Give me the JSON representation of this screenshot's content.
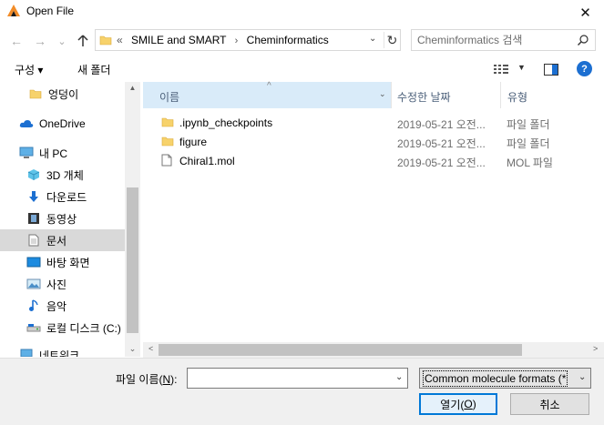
{
  "window": {
    "title": "Open File",
    "close_glyph": "✕",
    "app_icon": "app-logo-icon"
  },
  "nav": {
    "back_glyph": "←",
    "forward_glyph": "→",
    "recent_glyph": "⌄",
    "up_glyph": "🡡",
    "breadcrumb_prefix": "«",
    "breadcrumb": [
      "SMILE and SMART",
      "Cheminformatics"
    ],
    "breadcrumb_separator": "›",
    "search_placeholder": "Cheminformatics 검색"
  },
  "toolbar": {
    "organize_label": "구성 ▾",
    "new_folder_label": "새 폴더",
    "help_label": "?"
  },
  "sidebar": {
    "items": [
      {
        "label": "엉덩이",
        "icon": "folder-icon",
        "selected": false
      },
      {
        "label": "OneDrive",
        "icon": "cloud-icon",
        "selected": false
      },
      {
        "label": "내 PC",
        "icon": "computer-icon",
        "selected": false
      },
      {
        "label": "3D 개체",
        "icon": "cube-3d-icon",
        "selected": false
      },
      {
        "label": "다운로드",
        "icon": "download-arrow-icon",
        "selected": false
      },
      {
        "label": "동영상",
        "icon": "film-icon",
        "selected": false
      },
      {
        "label": "문서",
        "icon": "document-icon",
        "selected": true
      },
      {
        "label": "바탕 화면",
        "icon": "desktop-icon",
        "selected": false
      },
      {
        "label": "사진",
        "icon": "picture-icon",
        "selected": false
      },
      {
        "label": "음악",
        "icon": "music-note-icon",
        "selected": false
      },
      {
        "label": "로컬 디스크 (C:)",
        "icon": "drive-icon",
        "selected": false
      },
      {
        "label": "네트워크",
        "icon": "network-icon",
        "selected": false
      }
    ]
  },
  "file_list": {
    "columns": {
      "name": "이름",
      "date": "수정한 날짜",
      "type": "유형"
    },
    "rows": [
      {
        "name": ".ipynb_checkpoints",
        "date": "2019-05-21 오전...",
        "type": "파일 폴더",
        "icon": "folder-icon"
      },
      {
        "name": "figure",
        "date": "2019-05-21 오전...",
        "type": "파일 폴더",
        "icon": "folder-icon"
      },
      {
        "name": "Chiral1.mol",
        "date": "2019-05-21 오전...",
        "type": "MOL 파일",
        "icon": "file-icon"
      }
    ]
  },
  "footer": {
    "filename_label_prefix": "파일 이름(",
    "filename_label_key": "N",
    "filename_label_suffix": "):",
    "filename_value": "",
    "filter_value": "Common molecule formats (*",
    "open_prefix": "열기(",
    "open_key": "O",
    "open_suffix": ")",
    "cancel_label": "취소"
  },
  "colors": {
    "accent": "#0078d7",
    "header_selected": "#d9ebf9",
    "sidebar_selected": "#d9d9d9",
    "folder_yellow": "#f7d26b"
  }
}
